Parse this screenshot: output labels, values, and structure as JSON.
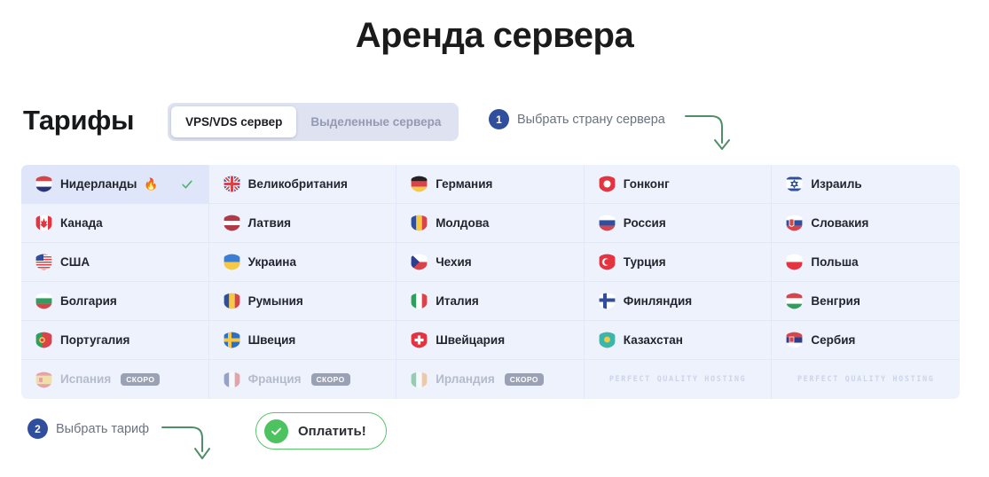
{
  "page": {
    "title": "Аренда сервера"
  },
  "controls": {
    "tariffs_heading": "Тарифы",
    "tabs": [
      {
        "label": "VPS/VDS сервер",
        "active": true
      },
      {
        "label": "Выделенные сервера",
        "active": false
      }
    ]
  },
  "steps": [
    {
      "number": "1",
      "label": "Выбрать страну сервера"
    },
    {
      "number": "2",
      "label": "Выбрать тариф"
    }
  ],
  "grid": {
    "columns": 5,
    "soon_badge": "СКОРО",
    "watermark": "PERFECT QUALITY HOSTING",
    "cells": [
      {
        "name": "Нидерланды",
        "flag": "nl",
        "selected": true,
        "hot": true,
        "checked": true
      },
      {
        "name": "Великобритания",
        "flag": "gb"
      },
      {
        "name": "Германия",
        "flag": "de"
      },
      {
        "name": "Гонконг",
        "flag": "hk"
      },
      {
        "name": "Израиль",
        "flag": "il"
      },
      {
        "name": "Канада",
        "flag": "ca"
      },
      {
        "name": "Латвия",
        "flag": "lv"
      },
      {
        "name": "Молдова",
        "flag": "md"
      },
      {
        "name": "Россия",
        "flag": "ru"
      },
      {
        "name": "Словакия",
        "flag": "sk"
      },
      {
        "name": "США",
        "flag": "us"
      },
      {
        "name": "Украина",
        "flag": "ua"
      },
      {
        "name": "Чехия",
        "flag": "cz"
      },
      {
        "name": "Турция",
        "flag": "tr"
      },
      {
        "name": "Польша",
        "flag": "pl"
      },
      {
        "name": "Болгария",
        "flag": "bg"
      },
      {
        "name": "Румыния",
        "flag": "ro"
      },
      {
        "name": "Италия",
        "flag": "it"
      },
      {
        "name": "Финляндия",
        "flag": "fi"
      },
      {
        "name": "Венгрия",
        "flag": "hu"
      },
      {
        "name": "Португалия",
        "flag": "pt"
      },
      {
        "name": "Швеция",
        "flag": "se"
      },
      {
        "name": "Швейцария",
        "flag": "ch"
      },
      {
        "name": "Казахстан",
        "flag": "kz"
      },
      {
        "name": "Сербия",
        "flag": "rs"
      },
      {
        "name": "Испания",
        "flag": "es",
        "disabled": true,
        "soon": true
      },
      {
        "name": "Франция",
        "flag": "fr",
        "disabled": true,
        "soon": true
      },
      {
        "name": "Ирландия",
        "flag": "ie",
        "disabled": true,
        "soon": true
      },
      {
        "watermark": true
      },
      {
        "watermark": true
      }
    ]
  },
  "pay_button": {
    "label": "Оплатить!",
    "icon": "check-circle-icon"
  },
  "colors": {
    "accent_blue": "#2f4f9e",
    "grid_bg": "#eef2fc",
    "selected_row": "#dfe6fa",
    "green": "#4cc35f",
    "arrow_green": "#4f8f68",
    "tab_bg": "#dfe2f1",
    "soon_badge": "#9aa1b4"
  }
}
